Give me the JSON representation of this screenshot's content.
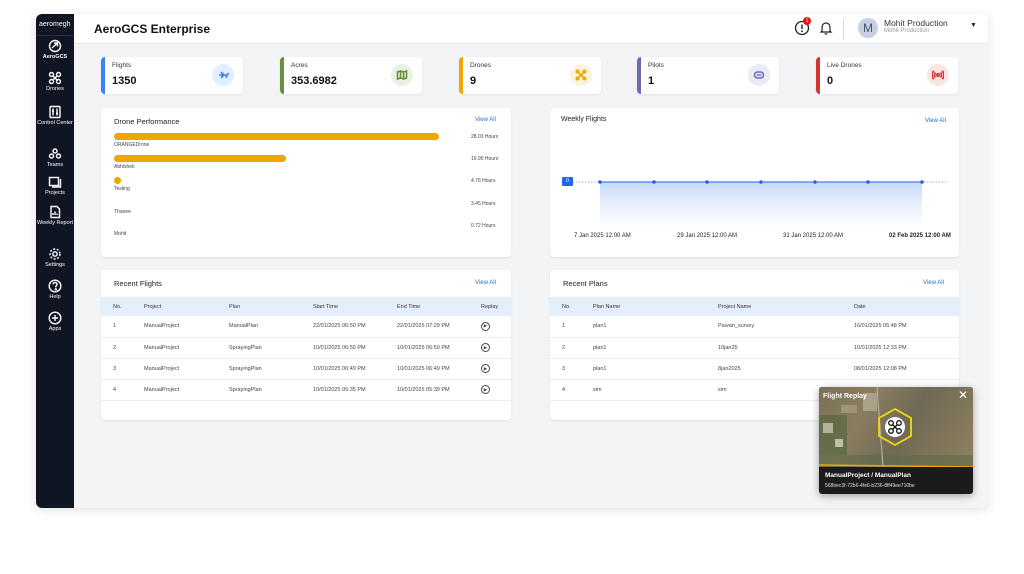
{
  "sidebar": {
    "logo": "aeromegh",
    "items": [
      {
        "label": "AeroGCS",
        "icon": "aerogcs-icon"
      },
      {
        "label": "Drones",
        "icon": "drone-icon"
      },
      {
        "label": "Control Center",
        "icon": "control-center-icon"
      },
      {
        "label": "Teams",
        "icon": "teams-icon"
      },
      {
        "label": "Projects",
        "icon": "projects-icon"
      },
      {
        "label": "Weekly Report",
        "icon": "report-icon"
      },
      {
        "label": "Settings",
        "icon": "gear-icon"
      },
      {
        "label": "Help",
        "icon": "help-icon"
      },
      {
        "label": "Apps",
        "icon": "plus-icon"
      }
    ]
  },
  "header": {
    "title": "AeroGCS Enterprise",
    "alert_count": "1",
    "avatar_letter": "M",
    "user_name": "Mohit Production",
    "user_org": "Mohit Production"
  },
  "stats": [
    {
      "label": "Flights",
      "value": "1350",
      "color": "#3b82f6",
      "icon": "plane-icon"
    },
    {
      "label": "Acres",
      "value": "353.6982",
      "color": "#6b8e3d",
      "icon": "map-icon"
    },
    {
      "label": "Drones",
      "value": "9",
      "color": "#f0a500",
      "icon": "drone-x-icon"
    },
    {
      "label": "Pilots",
      "value": "1",
      "color": "#6b6ab8",
      "icon": "pilot-icon"
    },
    {
      "label": "Live Drones",
      "value": "0",
      "color": "#d63232",
      "icon": "broadcast-icon"
    }
  ],
  "drone_performance": {
    "title": "Drone Performance",
    "view_all": "View All",
    "items": [
      {
        "name": "ORANGEDrone",
        "hours": "28.03 Hours",
        "fraction": 1.0
      },
      {
        "name": "Abhishek",
        "hours": "16.90 Hours",
        "fraction": 0.53
      },
      {
        "name": "Testing",
        "hours": "4.76 Hours",
        "fraction": 0.02
      },
      {
        "name": "Thanee",
        "hours": "3.45 Hours",
        "fraction": 0.0
      },
      {
        "name": "Mohit",
        "hours": "0.72 Hours",
        "fraction": 0.0
      }
    ]
  },
  "weekly_flights": {
    "title": "Weekly Flights",
    "view_all": "View All",
    "value_label": "0",
    "dates": [
      "7 Jan 2025 12:00 AM",
      "29 Jan 2025 12:00 AM",
      "31 Jan 2025 12:00 AM",
      "02 Feb 2025 12:00 AM"
    ]
  },
  "chart_data": {
    "type": "line",
    "title": "Weekly Flights",
    "x": [
      "7 Jan 2025 12:00 AM",
      "",
      "29 Jan 2025 12:00 AM",
      "",
      "31 Jan 2025 12:00 AM",
      "",
      "02 Feb 2025 12:00 AM"
    ],
    "series": [
      {
        "values": [
          0,
          0,
          0,
          0,
          0,
          0,
          0
        ]
      }
    ]
  },
  "recent_flights": {
    "title": "Recent Flights",
    "view_all": "View All",
    "columns": [
      "No.",
      "Project",
      "Plan",
      "Start Time",
      "End Time",
      "Replay"
    ],
    "rows": [
      [
        "1",
        "ManualProject",
        "ManualPlan",
        "22/01/2025 06:50 PM",
        "22/01/2025 07:29 PM"
      ],
      [
        "2",
        "ManualProject",
        "SprayingPlan",
        "10/01/2025 06:50 PM",
        "10/01/2025 06:50 PM"
      ],
      [
        "3",
        "ManualProject",
        "SprayingPlan",
        "10/01/2025 06:49 PM",
        "10/01/2025 06:49 PM"
      ],
      [
        "4",
        "ManualProject",
        "SprayingPlan",
        "10/01/2025 05:35 PM",
        "10/01/2025 05:39 PM"
      ]
    ]
  },
  "recent_plans": {
    "title": "Recent Plans",
    "view_all": "View All",
    "columns": [
      "No.",
      "Plan Name",
      "Project Name",
      "Date"
    ],
    "rows": [
      [
        "1",
        "plan1",
        "Pawan_survey",
        "16/01/2025 05:48 PM"
      ],
      [
        "2",
        "plan1",
        "10jan25",
        "10/01/2025 12:33 PM"
      ],
      [
        "3",
        "plan1",
        "8jan2025",
        "08/01/2025 12:08 PM"
      ],
      [
        "4",
        "sim",
        "sim",
        ""
      ]
    ]
  },
  "popup": {
    "title": "Flight Replay",
    "project": "ManualProject / ManualPlan",
    "id": "568bec3f-72b6-4fe6-b236-8ff49ee710be"
  }
}
